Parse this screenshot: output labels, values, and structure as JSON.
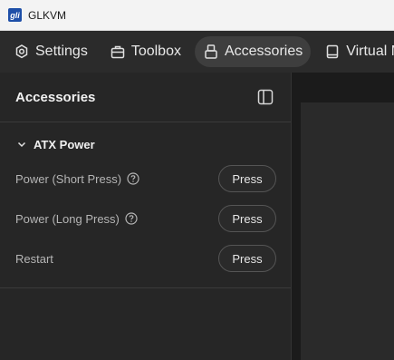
{
  "window": {
    "title": "GLKVM"
  },
  "nav": [
    {
      "label": "Settings",
      "icon": "gear-icon"
    },
    {
      "label": "Toolbox",
      "icon": "toolbox-icon"
    },
    {
      "label": "Accessories",
      "icon": "usb-plug-icon",
      "active": true
    },
    {
      "label": "Virtual M",
      "icon": "book-icon"
    }
  ],
  "panel": {
    "title": "Accessories",
    "section": {
      "title": "ATX Power",
      "rows": [
        {
          "label": "Power (Short Press)",
          "help": true,
          "button": "Press"
        },
        {
          "label": "Power (Long Press)",
          "help": true,
          "button": "Press"
        },
        {
          "label": "Restart",
          "help": false,
          "button": "Press"
        }
      ]
    }
  },
  "colors": {
    "background": "#1f1f1f",
    "panel": "#262626",
    "active_tab": "#3e3e3e"
  }
}
